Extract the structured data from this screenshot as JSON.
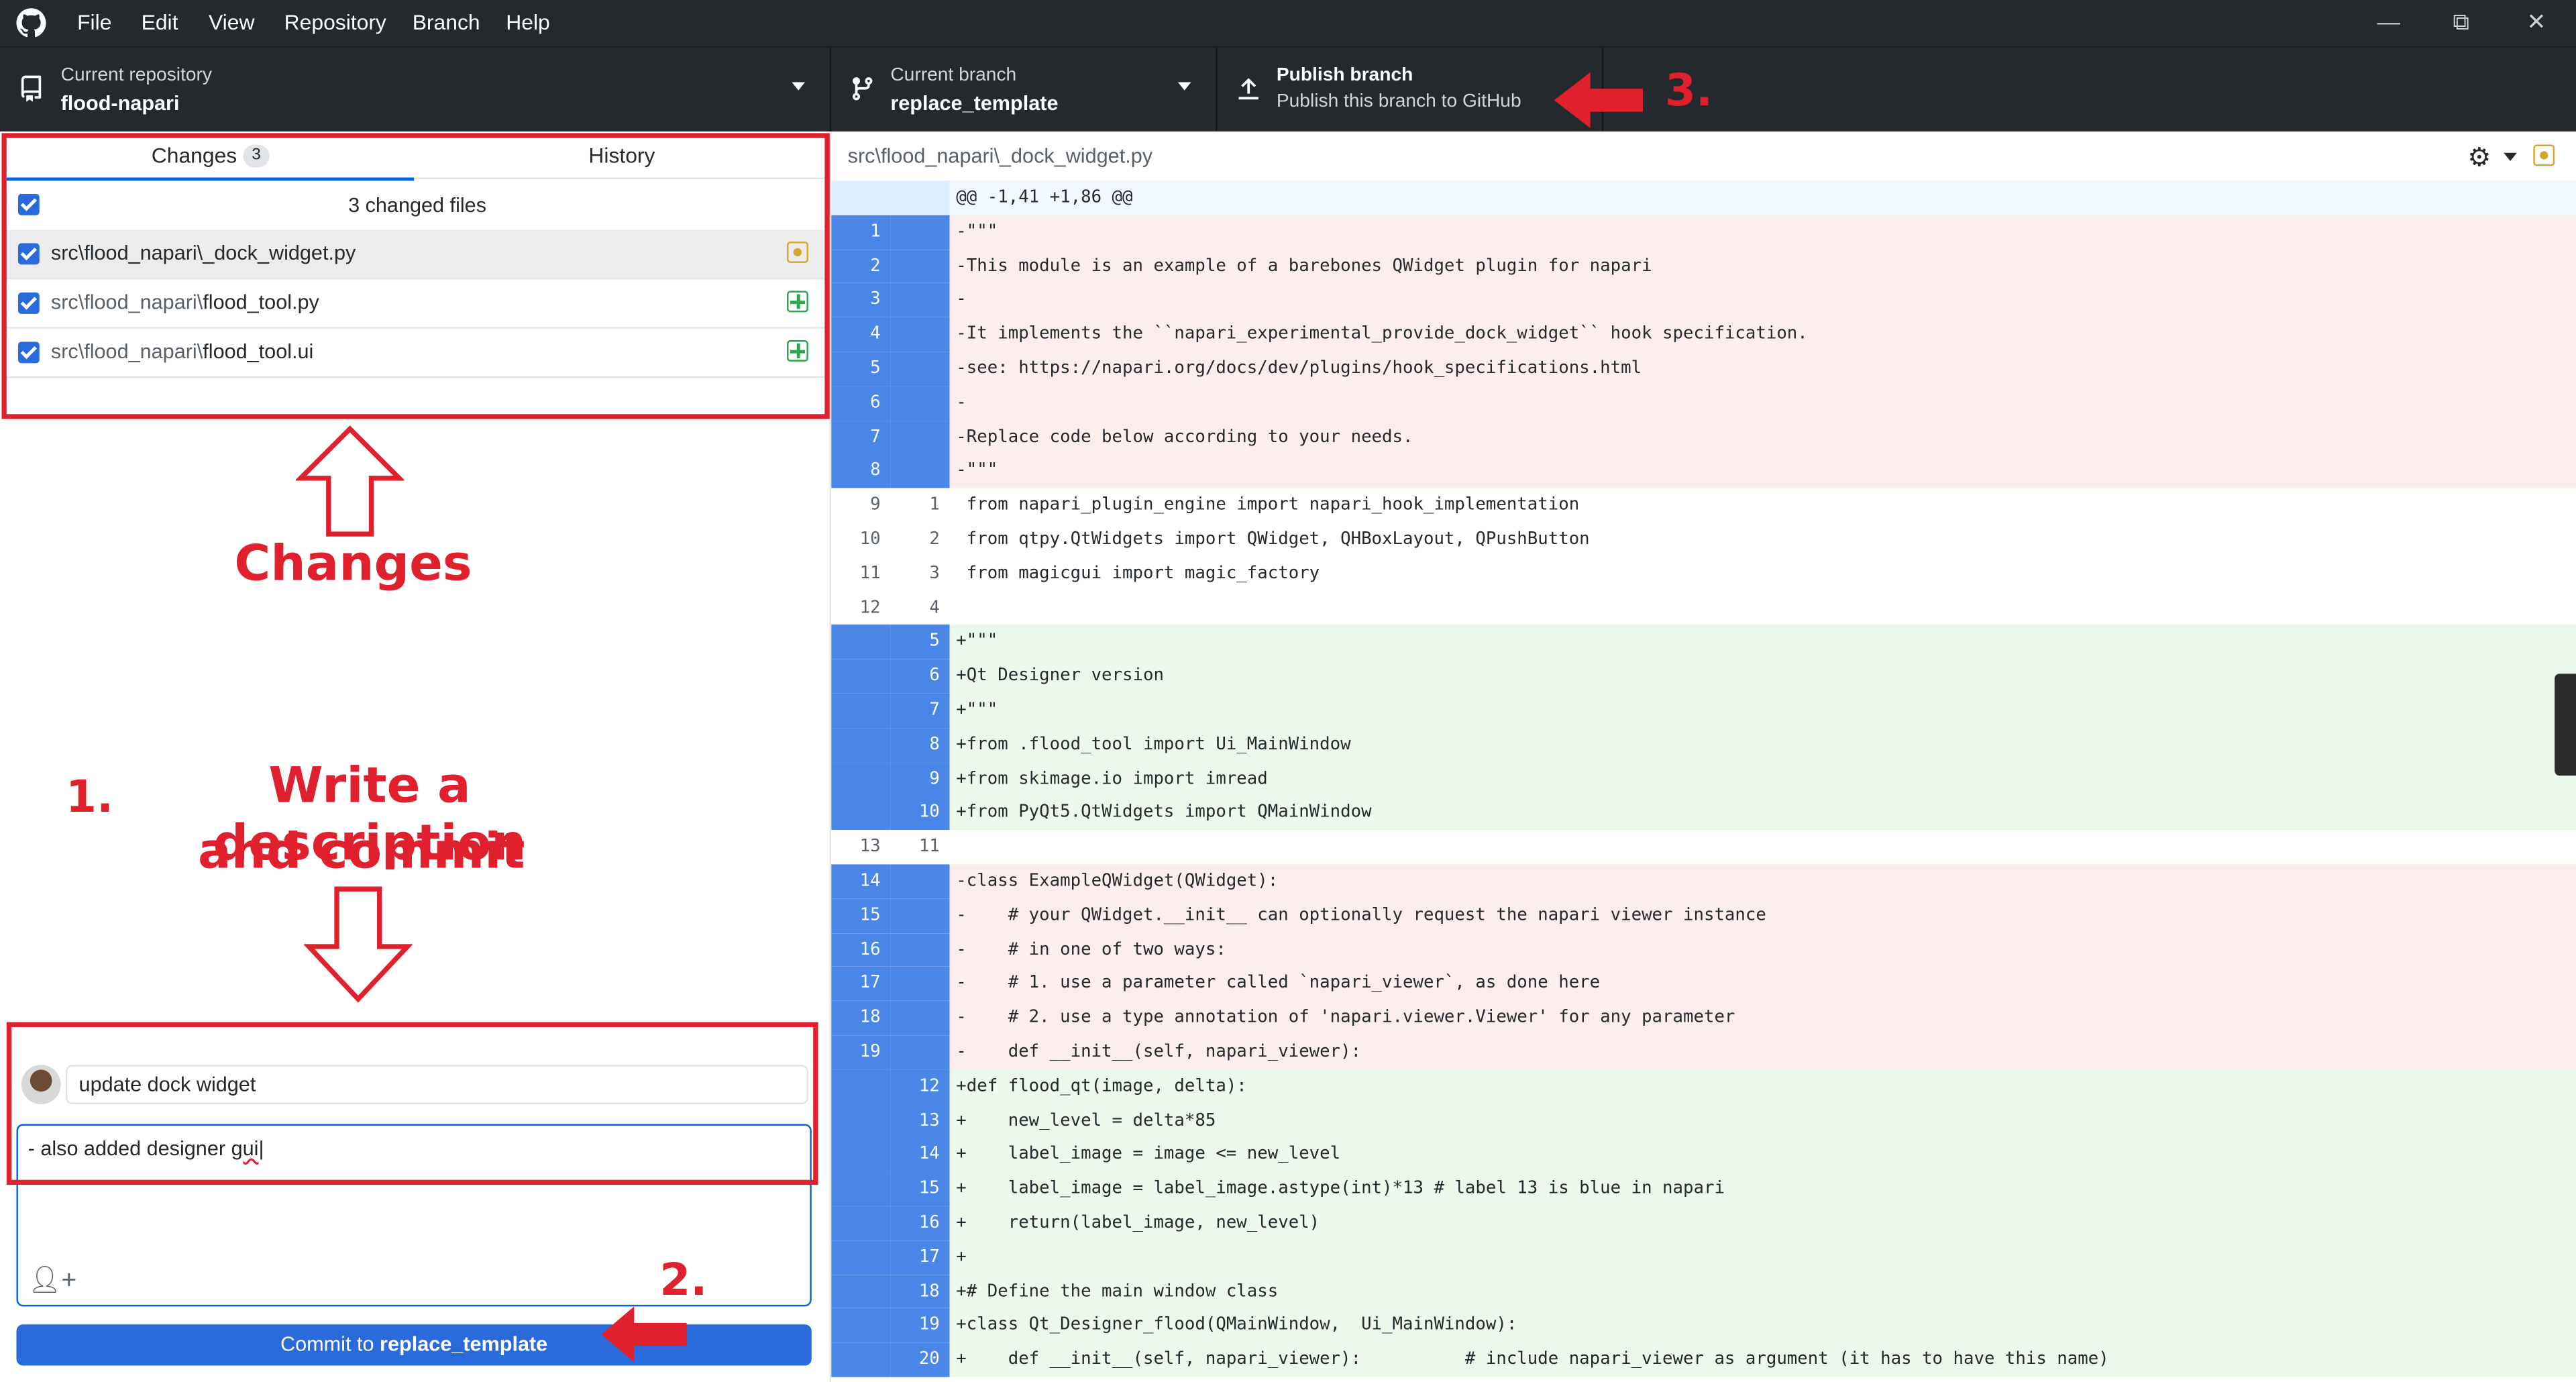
{
  "menubar": {
    "items": [
      "File",
      "Edit",
      "View",
      "Repository",
      "Branch",
      "Help"
    ]
  },
  "toolbar": {
    "repo_label": "Current repository",
    "repo_value": "flood-napari",
    "branch_label": "Current branch",
    "branch_value": "replace_template",
    "publish_label": "Publish branch",
    "publish_sub": "Publish this branch to GitHub"
  },
  "left": {
    "tab_changes": "Changes",
    "tab_changes_count": "3",
    "tab_history": "History",
    "changed_files_label": "3 changed files",
    "files": [
      {
        "dir": "src\\flood_napari\\",
        "name": "_dock_widget.py",
        "status": "modified",
        "selected": true
      },
      {
        "dir": "src\\flood_napari\\",
        "name": "flood_tool.py",
        "status": "added",
        "selected": false
      },
      {
        "dir": "src\\flood_napari\\",
        "name": "flood_tool.ui",
        "status": "added",
        "selected": false
      }
    ],
    "summary_value": "update dock widget",
    "description_value": "- also added designer gui",
    "commit_prefix": "Commit to ",
    "commit_branch": "replace_template"
  },
  "annotations": {
    "changes": "Changes",
    "step1_num": "1.",
    "step1_line1": "Write a description",
    "step1_line2": "and commit",
    "step2": "2.",
    "step3": "3."
  },
  "diff": {
    "file_path": "src\\flood_napari\\_dock_widget.py",
    "lines": [
      {
        "t": "hunk",
        "o": "",
        "n": "",
        "c": "@@ -1,41 +1,86 @@"
      },
      {
        "t": "del",
        "o": "1",
        "n": "",
        "c": "-\"\"\""
      },
      {
        "t": "del",
        "o": "2",
        "n": "",
        "c": "-This module is an example of a barebones QWidget plugin for napari"
      },
      {
        "t": "del",
        "o": "3",
        "n": "",
        "c": "-"
      },
      {
        "t": "del",
        "o": "4",
        "n": "",
        "c": "-It implements the ``napari_experimental_provide_dock_widget`` hook specification."
      },
      {
        "t": "del",
        "o": "5",
        "n": "",
        "c": "-see: https://napari.org/docs/dev/plugins/hook_specifications.html"
      },
      {
        "t": "del",
        "o": "6",
        "n": "",
        "c": "-"
      },
      {
        "t": "del",
        "o": "7",
        "n": "",
        "c": "-Replace code below according to your needs."
      },
      {
        "t": "del",
        "o": "8",
        "n": "",
        "c": "-\"\"\""
      },
      {
        "t": "ctx",
        "o": "9",
        "n": "1",
        "c": " from napari_plugin_engine import napari_hook_implementation"
      },
      {
        "t": "ctx",
        "o": "10",
        "n": "2",
        "c": " from qtpy.QtWidgets import QWidget, QHBoxLayout, QPushButton"
      },
      {
        "t": "ctx",
        "o": "11",
        "n": "3",
        "c": " from magicgui import magic_factory"
      },
      {
        "t": "ctx",
        "o": "12",
        "n": "4",
        "c": ""
      },
      {
        "t": "add",
        "o": "",
        "n": "5",
        "c": "+\"\"\""
      },
      {
        "t": "add",
        "o": "",
        "n": "6",
        "c": "+Qt Designer version"
      },
      {
        "t": "add",
        "o": "",
        "n": "7",
        "c": "+\"\"\""
      },
      {
        "t": "add",
        "o": "",
        "n": "8",
        "c": "+from .flood_tool import Ui_MainWindow"
      },
      {
        "t": "add",
        "o": "",
        "n": "9",
        "c": "+from skimage.io import imread"
      },
      {
        "t": "add",
        "o": "",
        "n": "10",
        "c": "+from PyQt5.QtWidgets import QMainWindow"
      },
      {
        "t": "ctx",
        "o": "13",
        "n": "11",
        "c": ""
      },
      {
        "t": "del",
        "o": "14",
        "n": "",
        "c": "-class ExampleQWidget(QWidget):"
      },
      {
        "t": "del",
        "o": "15",
        "n": "",
        "c": "-    # your QWidget.__init__ can optionally request the napari viewer instance"
      },
      {
        "t": "del",
        "o": "16",
        "n": "",
        "c": "-    # in one of two ways:"
      },
      {
        "t": "del",
        "o": "17",
        "n": "",
        "c": "-    # 1. use a parameter called `napari_viewer`, as done here"
      },
      {
        "t": "del",
        "o": "18",
        "n": "",
        "c": "-    # 2. use a type annotation of 'napari.viewer.Viewer' for any parameter"
      },
      {
        "t": "del",
        "o": "19",
        "n": "",
        "c": "-    def __init__(self, napari_viewer):"
      },
      {
        "t": "add",
        "o": "",
        "n": "12",
        "c": "+def flood_qt(image, delta):"
      },
      {
        "t": "add",
        "o": "",
        "n": "13",
        "c": "+    new_level = delta*85"
      },
      {
        "t": "add",
        "o": "",
        "n": "14",
        "c": "+    label_image = image <= new_level"
      },
      {
        "t": "add",
        "o": "",
        "n": "15",
        "c": "+    label_image = label_image.astype(int)*13 # label 13 is blue in napari"
      },
      {
        "t": "add",
        "o": "",
        "n": "16",
        "c": "+    return(label_image, new_level)"
      },
      {
        "t": "add",
        "o": "",
        "n": "17",
        "c": "+"
      },
      {
        "t": "add",
        "o": "",
        "n": "18",
        "c": "+# Define the main window class"
      },
      {
        "t": "add",
        "o": "",
        "n": "19",
        "c": "+class Qt_Designer_flood(QMainWindow,  Ui_MainWindow):"
      },
      {
        "t": "add",
        "o": "",
        "n": "20",
        "c": "+    def __init__(self, napari_viewer):          # include napari_viewer as argument (it has to have this name)"
      }
    ]
  },
  "colors": {
    "accent": "#2a6ada",
    "annotation": "#e0202c",
    "deleted_bg": "#fdeeee",
    "added_bg": "#eaf9ec",
    "gutter_changed": "#4a86e8"
  }
}
